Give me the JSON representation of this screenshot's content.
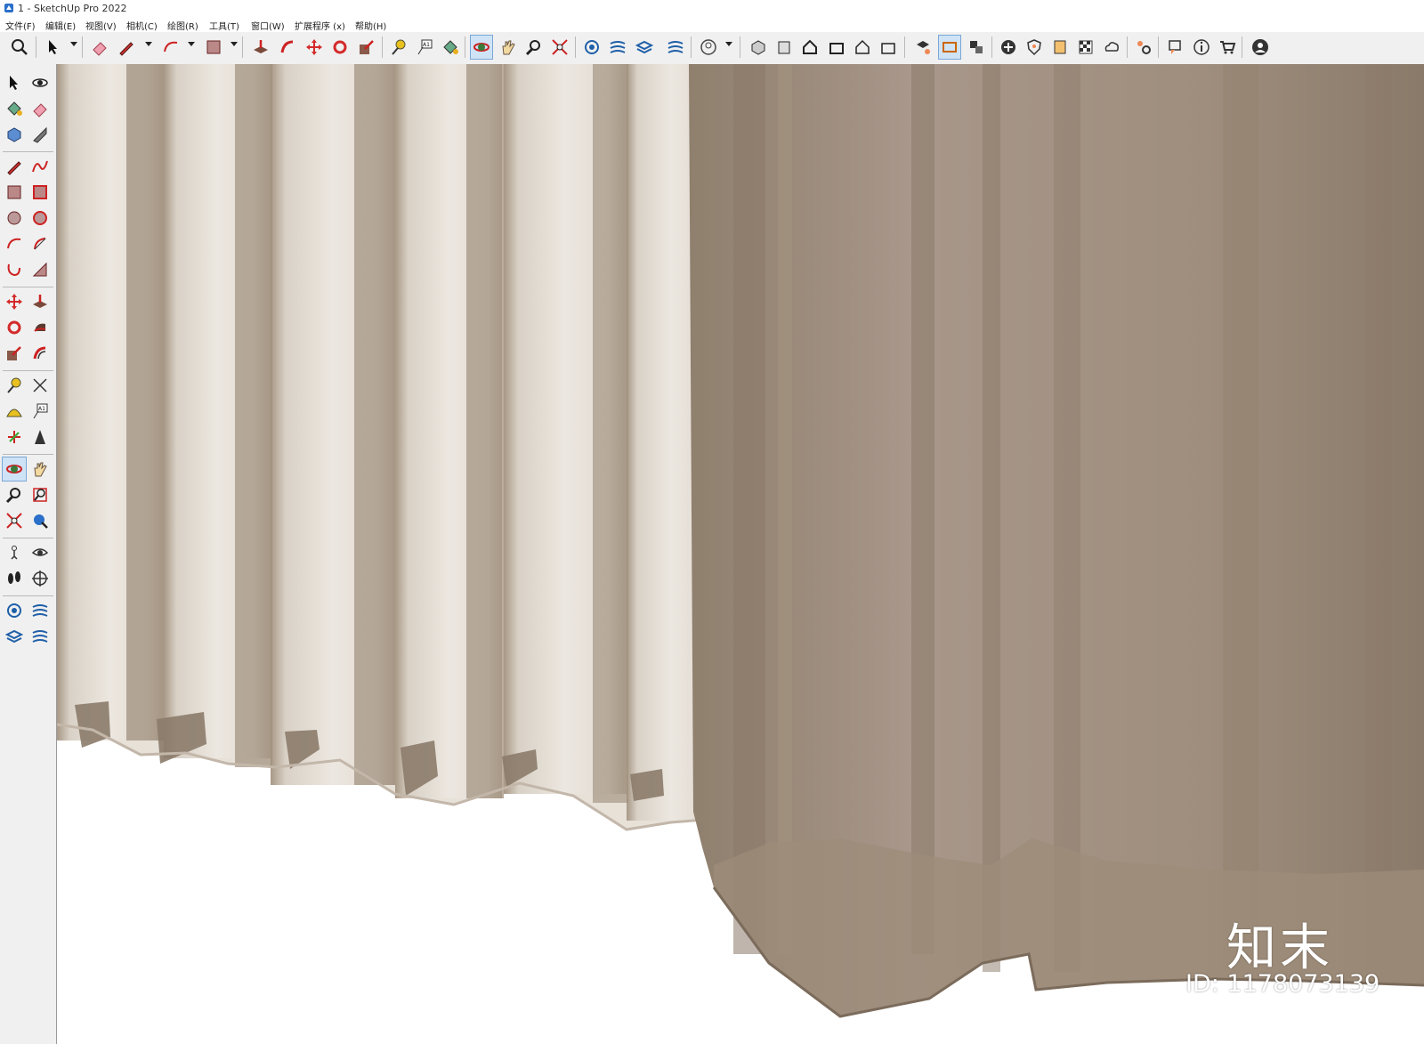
{
  "window": {
    "title": "1 - SketchUp Pro 2022"
  },
  "menu": [
    "文件(F)",
    "编辑(E)",
    "视图(V)",
    "相机(C)",
    "绘图(R)",
    "工具(T)",
    "窗口(W)",
    "扩展程序 (x)",
    "帮助(H)"
  ],
  "colors": {
    "toolbar_bg": "#f0f0f0",
    "accent_red": "#d42a2a",
    "active_blue": "#cfe3f7",
    "sheer_light": "#ebe6df",
    "sheer_dark": "#9d8c79",
    "hem_shadow": "#8b7b6a"
  },
  "toolbar_icons": [
    "search-icon",
    "select-icon",
    "eraser-icon",
    "pencil-icon",
    "arc-icon",
    "rectangle-icon",
    "push-pull-icon",
    "follow-me-icon",
    "move-icon",
    "rotate-icon",
    "scale-icon",
    "tape-measure-icon",
    "text-icon",
    "paint-bucket-icon",
    "orbit-icon",
    "pan-icon",
    "zoom-icon",
    "zoom-extents-icon",
    "warehouse-icon",
    "extension-icon",
    "layers-icon",
    "components-icon",
    "user-icon",
    "iso-view-icon",
    "top-view-icon",
    "front-view-icon",
    "right-view-icon",
    "back-view-icon",
    "left-view-icon",
    "section-icon",
    "display-section-icon",
    "scene-icon",
    "add-icon",
    "shield-icon",
    "materials-icon",
    "style-icon",
    "cloud-icon",
    "settings-icon",
    "comment-icon",
    "info-icon",
    "cart-icon",
    "account-icon"
  ],
  "left_toolbar_icons": [
    "select-icon",
    "orbit-icon",
    "paint-bucket-icon",
    "eraser-icon",
    "components-icon",
    "tag-icon",
    "pencil-icon",
    "freehand-icon",
    "rectangle-icon",
    "rotated-rectangle-icon",
    "circle-icon",
    "polygon-icon",
    "arc-icon",
    "pie-icon",
    "two-point-arc-icon",
    "three-point-arc-icon",
    "move-icon",
    "push-pull-icon",
    "rotate-icon",
    "follow-me-icon",
    "scale-icon",
    "offset-icon",
    "tape-measure-icon",
    "dimension-icon",
    "protractor-icon",
    "text-icon",
    "axes-icon",
    "3d-text-icon",
    "orbit-icon",
    "pan-icon",
    "zoom-icon",
    "zoom-window-icon",
    "zoom-extents-icon",
    "previous-view-icon",
    "position-camera-icon",
    "look-around-icon",
    "walk-icon",
    "section-plane-icon",
    "warehouse-icon",
    "extension-icon",
    "share-model-icon",
    "upload-icon"
  ],
  "watermark": {
    "logo": "知末",
    "id": "ID: 1178073139"
  }
}
